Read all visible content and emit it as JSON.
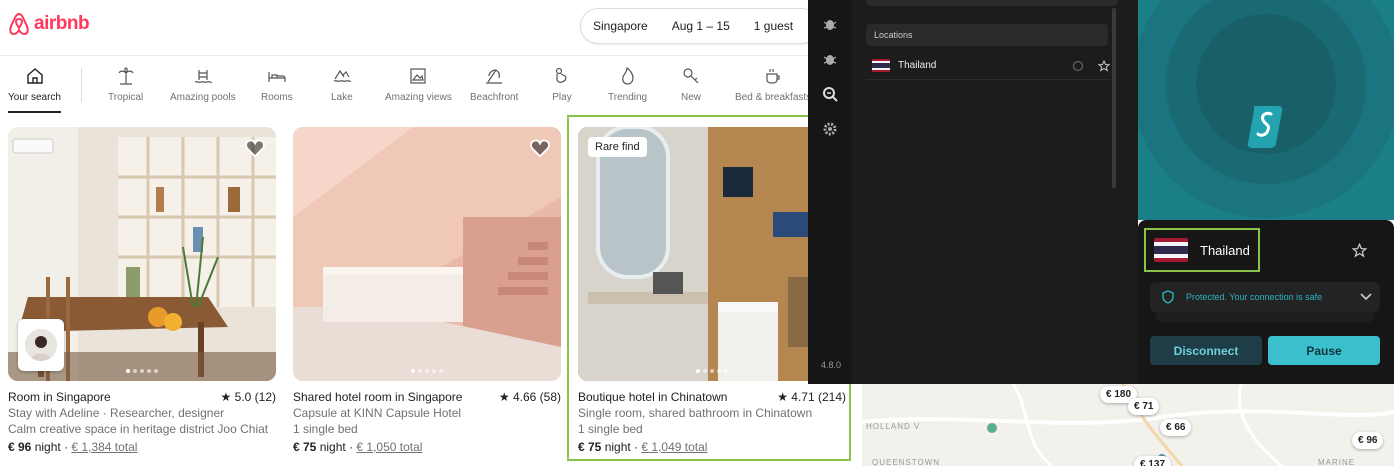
{
  "brand": {
    "name": "airbnb",
    "color": "#FF385C"
  },
  "search": {
    "location": "Singapore",
    "dates": "Aug 1 – 15",
    "guests": "1 guest"
  },
  "categories": [
    {
      "label": "Your search",
      "icon": "home-icon"
    },
    {
      "label": "Tropical",
      "icon": "palm-tree-icon"
    },
    {
      "label": "Amazing pools",
      "icon": "pool-icon"
    },
    {
      "label": "Rooms",
      "icon": "bed-icon"
    },
    {
      "label": "Lake",
      "icon": "lake-icon"
    },
    {
      "label": "Amazing views",
      "icon": "picture-icon"
    },
    {
      "label": "Beachfront",
      "icon": "beach-icon"
    },
    {
      "label": "Play",
      "icon": "play-icon"
    },
    {
      "label": "Trending",
      "icon": "flame-icon"
    },
    {
      "label": "New",
      "icon": "key-icon"
    },
    {
      "label": "Bed & breakfasts",
      "icon": "coffee-icon"
    }
  ],
  "listings": [
    {
      "title": "Room in Singapore",
      "rating": "5.0 (12)",
      "line1": "Stay with Adeline · Researcher, designer",
      "line2": "Calm creative space in heritage district Joo Chiat",
      "price": "€ 96",
      "unit": "night",
      "total": "€ 1,384 total"
    },
    {
      "title": "Shared hotel room in Singapore",
      "rating": "4.66 (58)",
      "line1": "Capsule at KINN Capsule Hotel",
      "line2": "1 single bed",
      "price": "€ 75",
      "unit": "night",
      "total": "€ 1,050 total"
    },
    {
      "title": "Boutique hotel in Chinatown",
      "rating": "4.71 (214)",
      "badge": "Rare find",
      "line1": "Single room, shared bathroom in Chinatown",
      "line2": "1 single bed",
      "price": "€ 75",
      "unit": "night",
      "total": "€ 1,049 total"
    }
  ],
  "map": {
    "pins": [
      "€ 180",
      "€ 71",
      "€ 66",
      "€ 96",
      "€ 137"
    ],
    "labels": [
      "HOLLAND V",
      "QUEENSTOWN",
      "MARINE PARADE"
    ]
  },
  "vpn": {
    "version": "4.8.0",
    "section_label": "Locations",
    "location_row": "Thailand",
    "connected_country": "Thailand",
    "status": "Protected. Your connection is safe",
    "disconnect_label": "Disconnect",
    "pause_label": "Pause",
    "accent": "#3bbfcc"
  }
}
